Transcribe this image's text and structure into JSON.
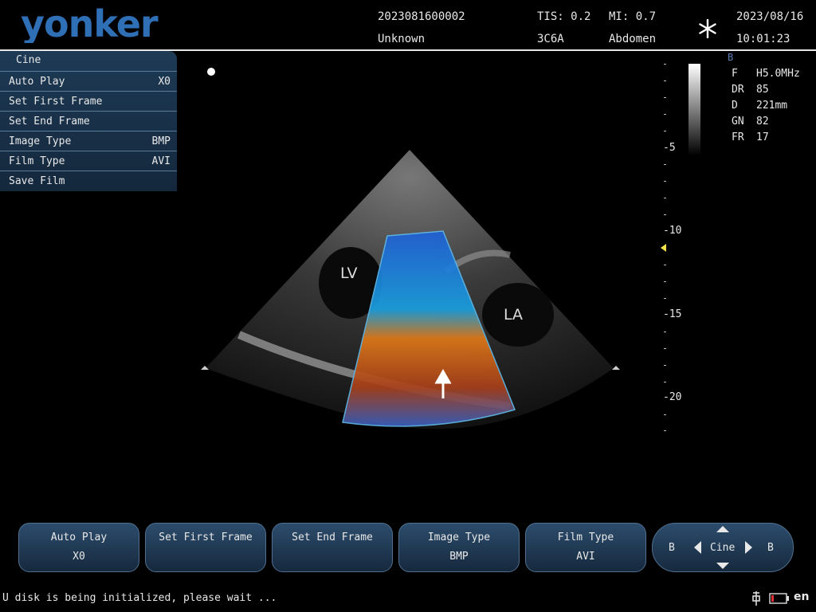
{
  "header": {
    "brand": "yonker",
    "patient_id": "2023081600002",
    "patient_name": "Unknown",
    "tis": "TIS: 0.2",
    "probe": "3C6A",
    "mi": "MI: 0.7",
    "exam": "Abdomen",
    "date": "2023/08/16",
    "time": "10:01:23",
    "icons": {
      "freeze": "snowflake-icon"
    }
  },
  "cine_menu": {
    "title": "Cine",
    "items": [
      {
        "label": "Auto Play",
        "value": "X0"
      },
      {
        "label": "Set First Frame",
        "value": ""
      },
      {
        "label": "Set End Frame",
        "value": ""
      },
      {
        "label": "Image Type",
        "value": "BMP"
      },
      {
        "label": "Film Type",
        "value": "AVI"
      },
      {
        "label": "Save Film",
        "value": ""
      }
    ]
  },
  "image_labels": {
    "lv": "LV",
    "la": "LA"
  },
  "depth_scale": {
    "labels": [
      "-5",
      "-10",
      "-15",
      "-20"
    ]
  },
  "params": {
    "mode": "B",
    "rows": [
      {
        "key": "F",
        "value": "H5.0MHz"
      },
      {
        "key": "DR",
        "value": "85"
      },
      {
        "key": "D",
        "value": "221mm"
      },
      {
        "key": "GN",
        "value": "82"
      },
      {
        "key": "FR",
        "value": "17"
      }
    ]
  },
  "bottom_buttons": [
    {
      "l1": "Auto Play",
      "l2": "X0"
    },
    {
      "l1": "Set First Frame",
      "l2": ""
    },
    {
      "l1": "Set End Frame",
      "l2": ""
    },
    {
      "l1": "Image Type",
      "l2": "BMP"
    },
    {
      "l1": "Film Type",
      "l2": "AVI"
    }
  ],
  "cine_nav": {
    "left": "B",
    "center": "Cine",
    "right": "B"
  },
  "status": {
    "message": "U disk is being initialized, please wait ...",
    "language": "en",
    "icons": {
      "usb": "usb-icon",
      "battery": "battery-icon"
    },
    "battery_color": "#e03030"
  },
  "colors": {
    "panel": "#1e3a55",
    "accent": "#3aa0e0",
    "focus": "#f2e24a"
  }
}
